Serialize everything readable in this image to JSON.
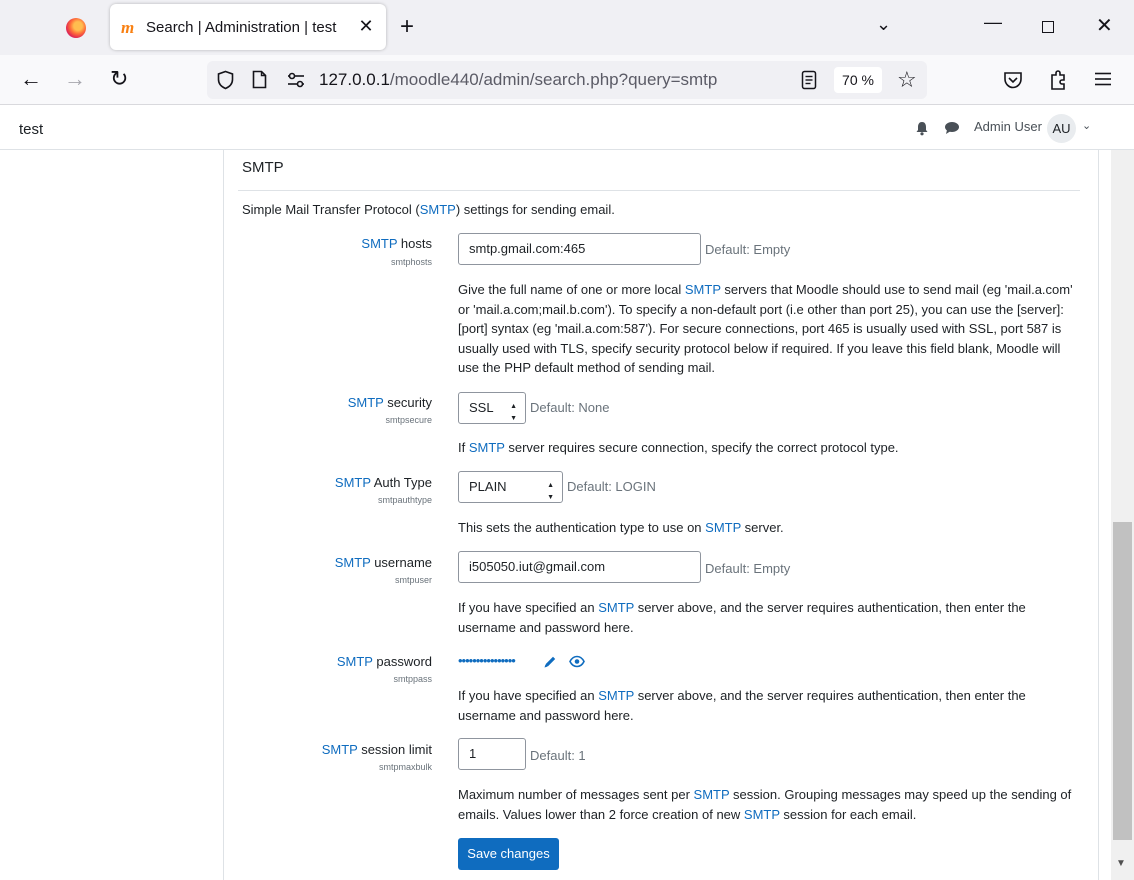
{
  "browser": {
    "tab_title": "Search | Administration | test",
    "tab_favicon": "m",
    "tab_close": "✕",
    "new_tab": "+",
    "tabs_list": "⌄",
    "win_min": "—",
    "win_close": "✕",
    "back": "←",
    "forward": "→",
    "reload": "↻",
    "url_host": "127.0.0.1",
    "url_path": "/moodle440/admin/search.php?query=smtp",
    "zoom": "70 %",
    "star": "☆",
    "icons": [
      "firefox-logo-icon",
      "shield-icon",
      "page-icon",
      "permissions-icon",
      "reader-view-icon",
      "bookmark-star-icon",
      "pocket-icon",
      "extensions-icon",
      "menu-icon"
    ]
  },
  "header": {
    "site_name": "test",
    "user_name": "Admin User",
    "avatar_initials": "AU",
    "caret": "⌄"
  },
  "section": {
    "heading": "SMTP",
    "desc_pre": "Simple Mail Transfer Protocol (",
    "desc_link": "SMTP",
    "desc_post": ") settings for sending email."
  },
  "settings": {
    "hosts": {
      "label_link": "SMTP",
      "label_rest": " hosts",
      "key": "smtphosts",
      "value": "smtp.gmail.com:465",
      "default": "Default: Empty",
      "help_1": "Give the full name of one or more local ",
      "help_link": "SMTP",
      "help_2": " servers that Moodle should use to send mail (eg 'mail.a.com' or 'mail.a.com;mail.b.com'). To specify a non-default port (i.e other than port 25), you can use the [server]:[port] syntax (eg 'mail.a.com:587'). For secure connections, port 465 is usually used with SSL, port 587 is usually used with TLS, specify security protocol below if required. If you leave this field blank, Moodle will use the PHP default method of sending mail."
    },
    "security": {
      "label_link": "SMTP",
      "label_rest": " security",
      "key": "smtpsecure",
      "value": "SSL",
      "default": "Default: None",
      "help_1": "If ",
      "help_link": "SMTP",
      "help_2": " server requires secure connection, specify the correct protocol type."
    },
    "authtype": {
      "label_link": "SMTP",
      "label_rest": " Auth Type",
      "key": "smtpauthtype",
      "value": "PLAIN",
      "default": "Default: LOGIN",
      "help_1": "This sets the authentication type to use on ",
      "help_link": "SMTP",
      "help_2": " server."
    },
    "username": {
      "label_link": "SMTP",
      "label_rest": " username",
      "key": "smtpuser",
      "value": "i505050.iut@gmail.com",
      "default": "Default: Empty",
      "help_1": "If you have specified an ",
      "help_link": "SMTP",
      "help_2": " server above, and the server requires authentication, then enter the username and password here."
    },
    "password": {
      "label_link": "SMTP",
      "label_rest": " password",
      "key": "smtppass",
      "value_masked": "••••••••••••••••",
      "help_1": "If you have specified an ",
      "help_link": "SMTP",
      "help_2": " server above, and the server requires authentication, then enter the username and password here."
    },
    "maxbulk": {
      "label_link": "SMTP",
      "label_rest": " session limit",
      "key": "smtpmaxbulk",
      "value": "1",
      "default": "Default: 1",
      "help_1": "Maximum number of messages sent per ",
      "help_link": "SMTP",
      "help_2": " session. Grouping messages may speed up the sending of emails. Values lower than 2 force creation of new ",
      "help_link2": "SMTP",
      "help_3": " session for each email."
    }
  },
  "save_label": "Save changes",
  "colors": {
    "link": "#0f6cbf",
    "primary_button": "#0f6cbf",
    "muted": "#6a737b"
  }
}
